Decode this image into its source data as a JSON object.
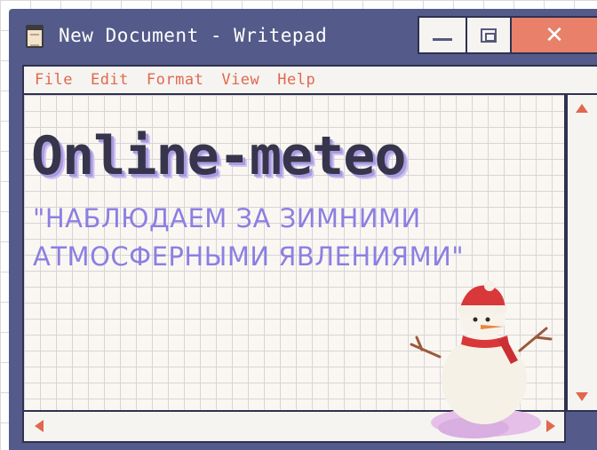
{
  "window": {
    "title": "New Document - Writepad",
    "controls": {
      "minimize": "—",
      "maximize": "▢",
      "close": "✕"
    }
  },
  "menu": {
    "items": [
      "File",
      "Edit",
      "Format",
      "View",
      "Help"
    ]
  },
  "document": {
    "title": "Online-meteo",
    "subtitle_line1": "\"НАБЛЮДАЕМ ЗА ЗИМНИМИ",
    "subtitle_line2": "АТМОСФЕРНЫМИ ЯВЛЕНИЯМИ\""
  },
  "colors": {
    "titlebar": "#545b8a",
    "accent": "#e0684f",
    "subtitle": "#8c7fe2",
    "close_button": "#e8806a"
  },
  "icons": {
    "app": "notepad-icon",
    "decoration": "snowman-illustration"
  }
}
